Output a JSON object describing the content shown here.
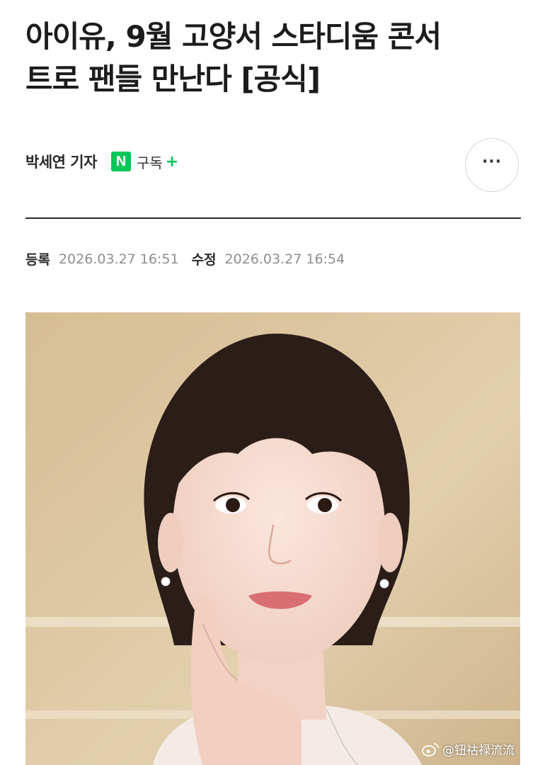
{
  "article": {
    "headline_line1": "아이유, 9월 고양서 스타디움 콘서",
    "headline_line2": "트로 팬들 만난다 [공식]",
    "reporter": "박세연 기자",
    "press_badge": "N",
    "subscribe_label": "구독",
    "subscribe_plus": "+",
    "more_label": "···",
    "registered_label": "등록",
    "registered_time": "2026.03.27 16:51",
    "modified_label": "수정",
    "modified_time": "2026.03.27 16:54"
  },
  "photo": {
    "watermark": "@钮祜禄流流"
  },
  "colors": {
    "naver_green": "#03c75a",
    "headline": "#1c1c1c",
    "meta_gray": "#8e8e8e",
    "photo_background": "#d9c39c"
  },
  "icons": {
    "press_badge": "naver-n-icon",
    "more": "more-dots-icon",
    "watermark": "weibo-icon"
  }
}
